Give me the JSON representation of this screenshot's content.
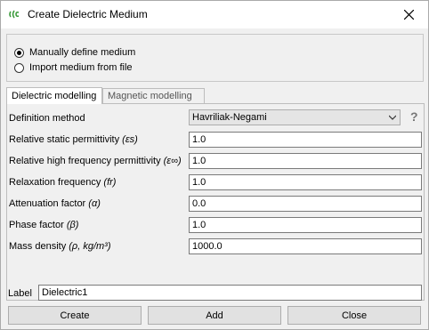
{
  "window": {
    "title": "Create Dielectric Medium",
    "app_icon": "cst-logo-icon",
    "close_icon": "close-icon"
  },
  "source_options": [
    {
      "label": "Manually define medium",
      "checked": true
    },
    {
      "label": "Import medium from file",
      "checked": false
    }
  ],
  "tabs": [
    {
      "label": "Dielectric modelling",
      "active": true
    },
    {
      "label": "Magnetic modelling",
      "active": false
    }
  ],
  "definition_method": {
    "label": "Definition method",
    "value": "Havriliak-Negami",
    "help": "?"
  },
  "fields": {
    "static_permittivity": {
      "label": "Relative static permittivity",
      "symbol": "(εs)",
      "value": "1.0"
    },
    "hf_permittivity": {
      "label": "Relative high frequency permittivity",
      "symbol": "(ε∞)",
      "value": "1.0"
    },
    "relaxation": {
      "label": "Relaxation frequency",
      "symbol": "(fr)",
      "value": "1.0"
    },
    "attenuation": {
      "label": "Attenuation factor",
      "symbol": "(α)",
      "value": "0.0"
    },
    "phase": {
      "label": "Phase factor",
      "symbol": "(β)",
      "value": "1.0"
    },
    "density": {
      "label": "Mass density",
      "symbol": "(ρ, kg/m³)",
      "value": "1000.0"
    }
  },
  "label_field": {
    "label": "Label",
    "value": "Dielectric1"
  },
  "buttons": {
    "create": "Create",
    "add": "Add",
    "close": "Close"
  },
  "colors": {
    "title_bg": "#ffffff",
    "dialog_bg": "#f0f0f0",
    "icon_green": "#3a9a3a"
  }
}
